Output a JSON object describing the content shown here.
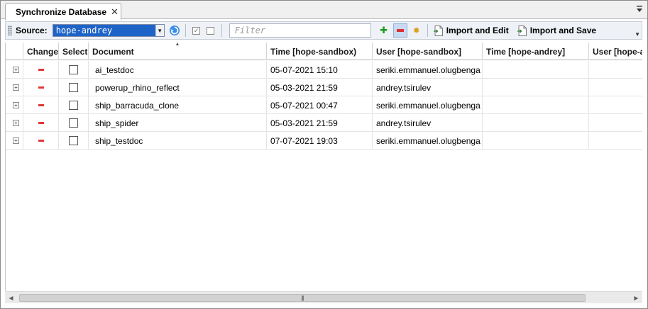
{
  "tab": {
    "title": "Synchronize Database"
  },
  "toolbar": {
    "source_label": "Source:",
    "source_value": "hope-andrey",
    "filter_placeholder": "Filter",
    "import_edit_label": "Import and Edit",
    "import_save_label": "Import and Save"
  },
  "columns": [
    "",
    "Change",
    "Select",
    "Document",
    "Time [hope-sandbox)",
    "User [hope-sandbox]",
    "Time [hope-andrey]",
    "User [hope-a"
  ],
  "rows": [
    {
      "document": "ai_testdoc",
      "time_sandbox": "05-07-2021 15:10",
      "user_sandbox": "seriki.emmanuel.olugbenga",
      "time_andrey": "",
      "user_andrey": ""
    },
    {
      "document": "powerup_rhino_reflect",
      "time_sandbox": "05-03-2021 21:59",
      "user_sandbox": "andrey.tsirulev",
      "time_andrey": "",
      "user_andrey": ""
    },
    {
      "document": "ship_barracuda_clone",
      "time_sandbox": "05-07-2021 00:47",
      "user_sandbox": "seriki.emmanuel.olugbenga",
      "time_andrey": "",
      "user_andrey": ""
    },
    {
      "document": "ship_spider",
      "time_sandbox": "05-03-2021 21:59",
      "user_sandbox": "andrey.tsirulev",
      "time_andrey": "",
      "user_andrey": ""
    },
    {
      "document": "ship_testdoc",
      "time_sandbox": "07-07-2021 19:03",
      "user_sandbox": "seriki.emmanuel.olugbenga",
      "time_andrey": "",
      "user_andrey": ""
    }
  ],
  "colors": {
    "accent_blue": "#1e64c8",
    "change_red": "#e03838",
    "add_green": "#1a9c1a"
  },
  "icons": {
    "expand": "plus-box-icon",
    "change": "minus-icon",
    "refresh": "refresh-icon",
    "gear": "gear-icon"
  }
}
